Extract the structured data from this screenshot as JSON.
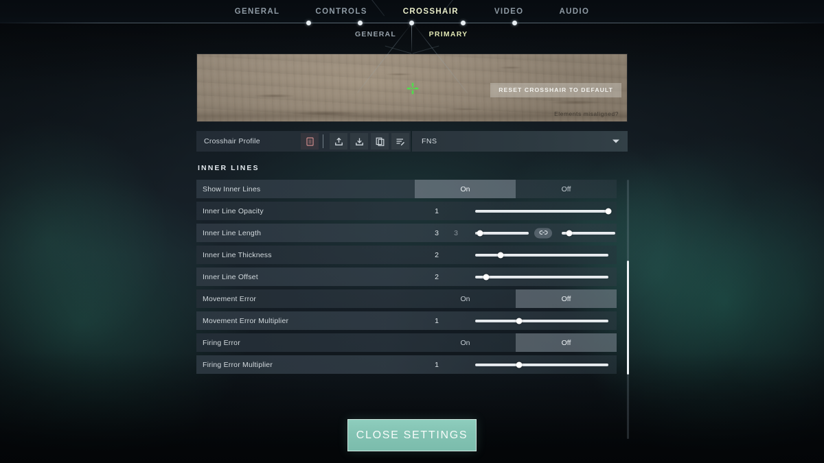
{
  "nav": {
    "tabs": [
      {
        "label": "GENERAL",
        "active": false
      },
      {
        "label": "CONTROLS",
        "active": false
      },
      {
        "label": "CROSSHAIR",
        "active": true
      },
      {
        "label": "VIDEO",
        "active": false
      },
      {
        "label": "AUDIO",
        "active": false
      }
    ],
    "subtabs": [
      {
        "label": "GENERAL",
        "active": false
      },
      {
        "label": "PRIMARY",
        "active": true
      }
    ]
  },
  "preview": {
    "reset_label": "RESET CROSSHAIR TO DEFAULT",
    "misaligned_label": "Elements misaligned?",
    "crosshair_color": "#4fe04a"
  },
  "profile": {
    "label": "Crosshair Profile",
    "value": "FNS",
    "icons": [
      {
        "name": "delete-icon",
        "title": "Delete"
      },
      {
        "name": "upload-icon",
        "title": "Import"
      },
      {
        "name": "download-icon",
        "title": "Export"
      },
      {
        "name": "copy-icon",
        "title": "Duplicate"
      },
      {
        "name": "rename-icon",
        "title": "Rename"
      }
    ]
  },
  "section": {
    "title": "INNER LINES"
  },
  "toggle_options": {
    "on": "On",
    "off": "Off"
  },
  "rows": [
    {
      "label": "Show Inner Lines",
      "type": "toggle",
      "value": "On"
    },
    {
      "label": "Inner Line Opacity",
      "type": "slider",
      "value": "1",
      "pos": 100
    },
    {
      "label": "Inner Line Length",
      "type": "dual",
      "value": "3",
      "value2": "3",
      "pos": 9,
      "pos2": 14,
      "link": true
    },
    {
      "label": "Inner Line Thickness",
      "type": "slider",
      "value": "2",
      "pos": 19
    },
    {
      "label": "Inner Line Offset",
      "type": "slider",
      "value": "2",
      "pos": 8
    },
    {
      "label": "Movement Error",
      "type": "toggle",
      "value": "Off"
    },
    {
      "label": "Movement Error Multiplier",
      "type": "slider",
      "value": "1",
      "pos": 33
    },
    {
      "label": "Firing Error",
      "type": "toggle",
      "value": "Off"
    },
    {
      "label": "Firing Error Multiplier",
      "type": "slider",
      "value": "1",
      "pos": 33
    }
  ],
  "footer": {
    "close_label": "CLOSE SETTINGS"
  },
  "colors": {
    "accent_green": "#83c3b3",
    "active_tab": "#e8ecc8",
    "crosshair": "#4fe04a",
    "row_bg": "#2e3943"
  }
}
